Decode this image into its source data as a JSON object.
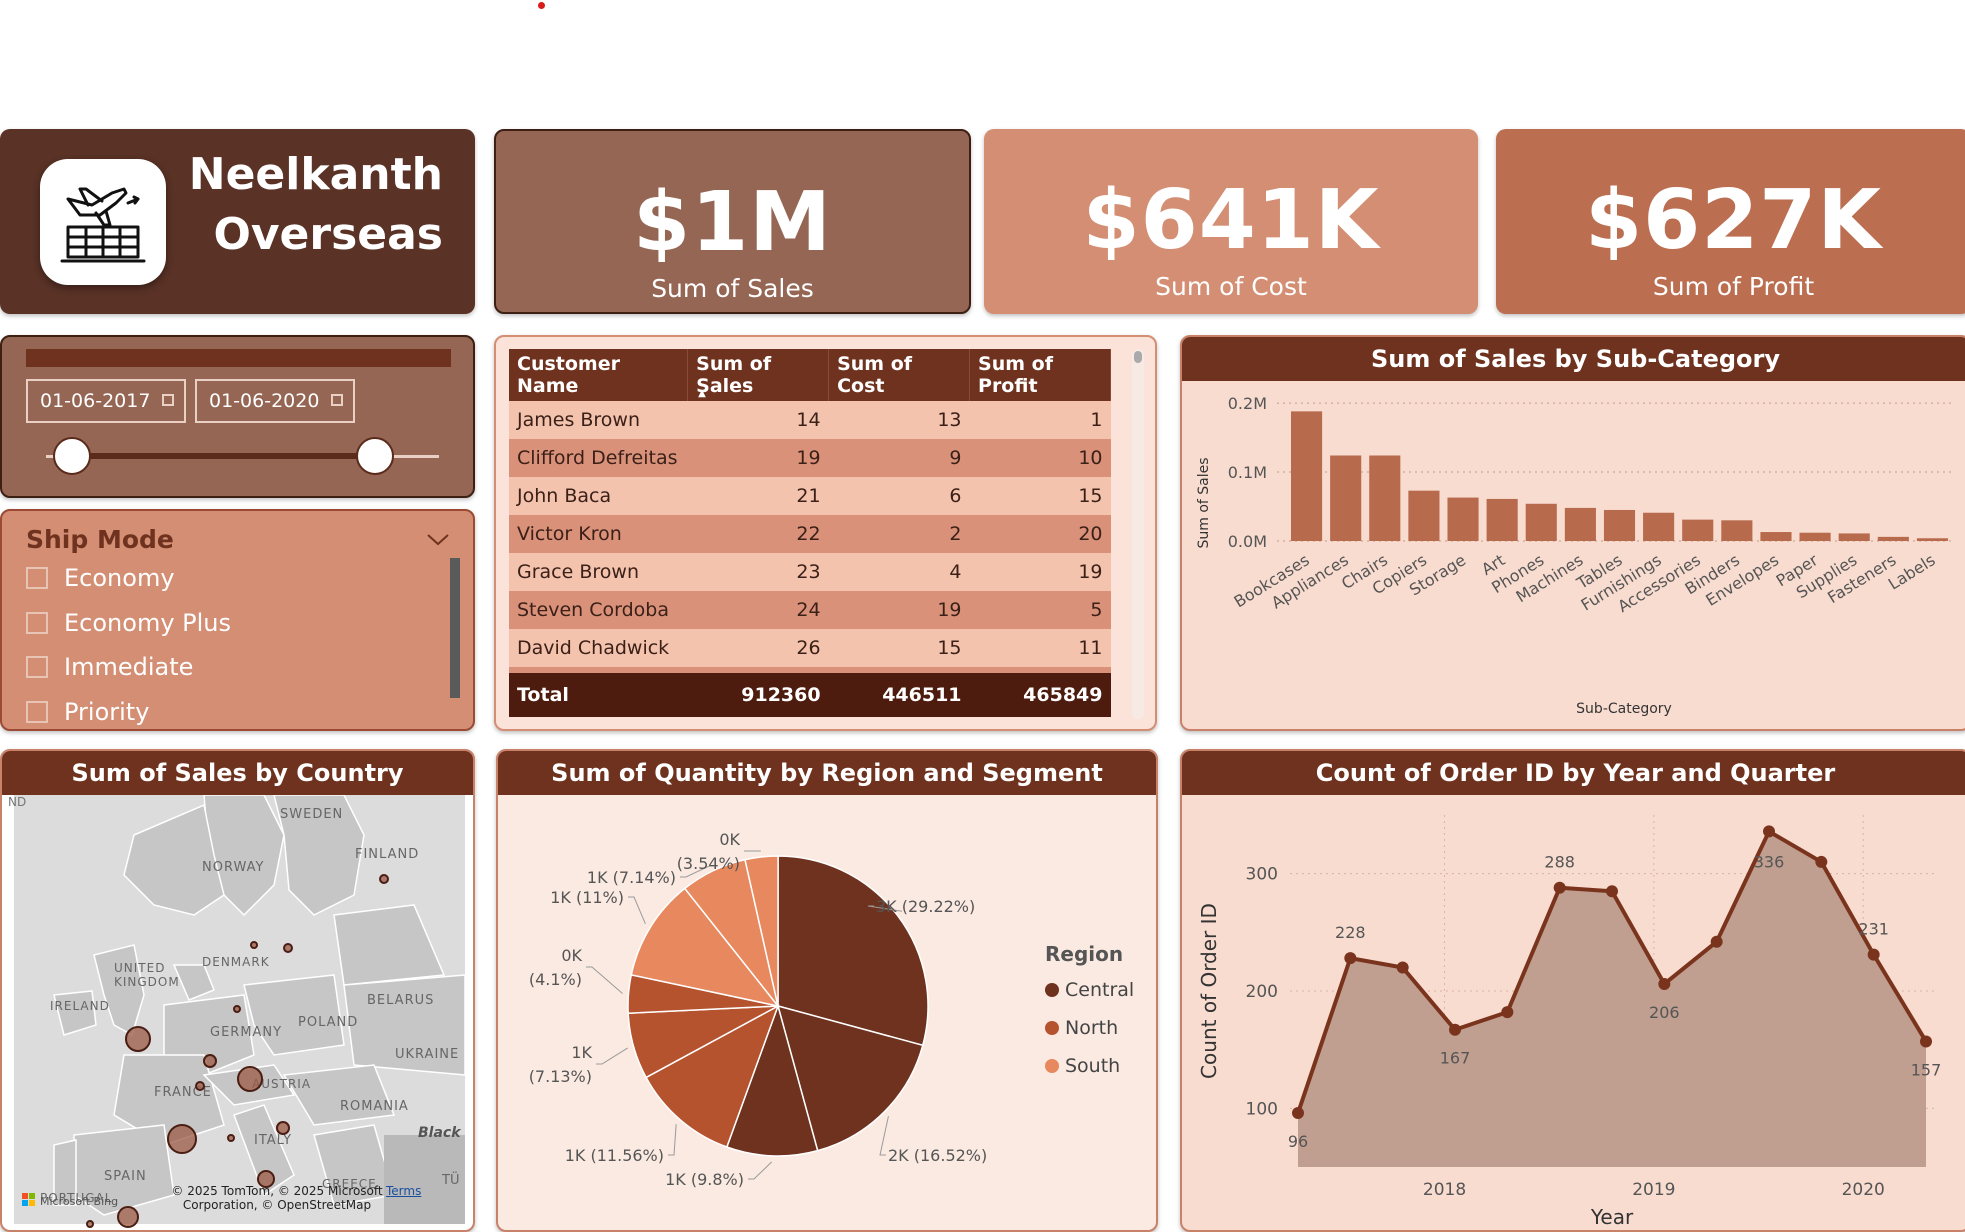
{
  "brand": {
    "line1": "Neelkanth",
    "line2": "Overseas"
  },
  "kpis": [
    {
      "value": "$1M",
      "label": "Sum of Sales"
    },
    {
      "value": "$641K",
      "label": "Sum of Cost"
    },
    {
      "value": "$627K",
      "label": "Sum of Profit"
    }
  ],
  "date_slicer": {
    "start": "01-06-2017",
    "end": "01-06-2020",
    "start_fraction": 0.0,
    "end_fraction": 1.0
  },
  "ship_mode": {
    "title": "Ship Mode",
    "options": [
      "Economy",
      "Economy Plus",
      "Immediate",
      "Priority"
    ]
  },
  "table": {
    "headers": [
      "Customer Name",
      "Sum of Sales",
      "Sum of Cost",
      "Sum of Profit"
    ],
    "rows": [
      [
        "James Brown",
        "14",
        "13",
        "1"
      ],
      [
        "Clifford Defreitas",
        "19",
        "9",
        "10"
      ],
      [
        "John Baca",
        "21",
        "6",
        "15"
      ],
      [
        "Victor Kron",
        "22",
        "2",
        "20"
      ],
      [
        "Grace Brown",
        "23",
        "4",
        "19"
      ],
      [
        "Steven Cordoba",
        "24",
        "19",
        "5"
      ],
      [
        "David Chadwick",
        "26",
        "15",
        "11"
      ]
    ],
    "total": [
      "Total",
      "912360",
      "446511",
      "465849"
    ]
  },
  "map": {
    "title": "Sum of Sales by Country",
    "labels": [
      "SWEDEN",
      "FINLAND",
      "NORWAY",
      "DENMARK",
      "UNITED KINGDOM",
      "IRELAND",
      "BELARUS",
      "POLAND",
      "GERMANY",
      "UKRAINE",
      "FRANCE",
      "AUSTRIA",
      "ROMANIA",
      "ITALY",
      "SPAIN",
      "PORTUGAL",
      "GREECE",
      "Black",
      "ND",
      "TÜ"
    ],
    "attribution": "© 2025 TomTom, © 2025 Microsoft Corporation, © OpenStreetMap",
    "terms": "Terms",
    "bing": "Microsoft Bing"
  },
  "pie": {
    "title": "Sum of Quantity by Region and Segment",
    "legend_title": "Region",
    "legend": [
      {
        "name": "Central",
        "color": "#6e321f"
      },
      {
        "name": "North",
        "color": "#b5532f"
      },
      {
        "name": "South",
        "color": "#e8885e"
      }
    ]
  },
  "line": {
    "title": "Count of Order ID by Year and Quarter",
    "xlabel": "Year",
    "ylabel": "Count of Order ID"
  },
  "chart_data": [
    {
      "type": "bar",
      "title": "Sum of Sales by Sub-Category",
      "xlabel": "Sub-Category",
      "ylabel": "Sum of Sales",
      "categories": [
        "Bookcases",
        "Appliances",
        "Chairs",
        "Copiers",
        "Storage",
        "Art",
        "Phones",
        "Machines",
        "Tables",
        "Furnishings",
        "Accessories",
        "Binders",
        "Envelopes",
        "Paper",
        "Supplies",
        "Fasteners",
        "Labels"
      ],
      "values": [
        0.188,
        0.124,
        0.124,
        0.073,
        0.063,
        0.061,
        0.054,
        0.048,
        0.045,
        0.041,
        0.031,
        0.03,
        0.013,
        0.012,
        0.011,
        0.006,
        0.004
      ],
      "yticks": [
        "0.0M",
        "0.1M",
        "0.2M"
      ],
      "ylim": [
        0,
        0.2
      ],
      "grid": true,
      "color": "#b86a4d"
    },
    {
      "type": "pie",
      "title": "Sum of Quantity by Region and Segment",
      "slices": [
        {
          "label": "3K (29.22%)",
          "percent": 29.22,
          "region": "Central"
        },
        {
          "label": "2K (16.52%)",
          "percent": 16.52,
          "region": "Central"
        },
        {
          "label": "1K (9.8%)",
          "percent": 9.8,
          "region": "Central"
        },
        {
          "label": "1K (11.56%)",
          "percent": 11.56,
          "region": "North"
        },
        {
          "label": "1K (7.13%)",
          "percent": 7.13,
          "region": "North"
        },
        {
          "label": "0K (4.1%)",
          "percent": 4.1,
          "region": "North"
        },
        {
          "label": "1K (11%)",
          "percent": 11.0,
          "region": "South"
        },
        {
          "label": "1K (7.14%)",
          "percent": 7.14,
          "region": "South"
        },
        {
          "label": "0K (3.54%)",
          "percent": 3.54,
          "region": "South"
        }
      ]
    },
    {
      "type": "area",
      "title": "Count of Order ID by Year and Quarter",
      "xlabel": "Year",
      "ylabel": "Count of Order ID",
      "xticks": [
        "2018",
        "2019",
        "2020"
      ],
      "yticks": [
        100,
        200,
        300
      ],
      "ylim": [
        50,
        350
      ],
      "values": [
        96,
        228,
        220,
        167,
        182,
        288,
        285,
        206,
        242,
        336,
        310,
        231,
        157
      ],
      "data_labels": {
        "0": "96",
        "1": "228",
        "3": "167",
        "5": "288",
        "7": "206",
        "9": "336",
        "11": "231",
        "12": "157"
      },
      "color": "#7a341d",
      "fill": "#c09f90"
    }
  ]
}
